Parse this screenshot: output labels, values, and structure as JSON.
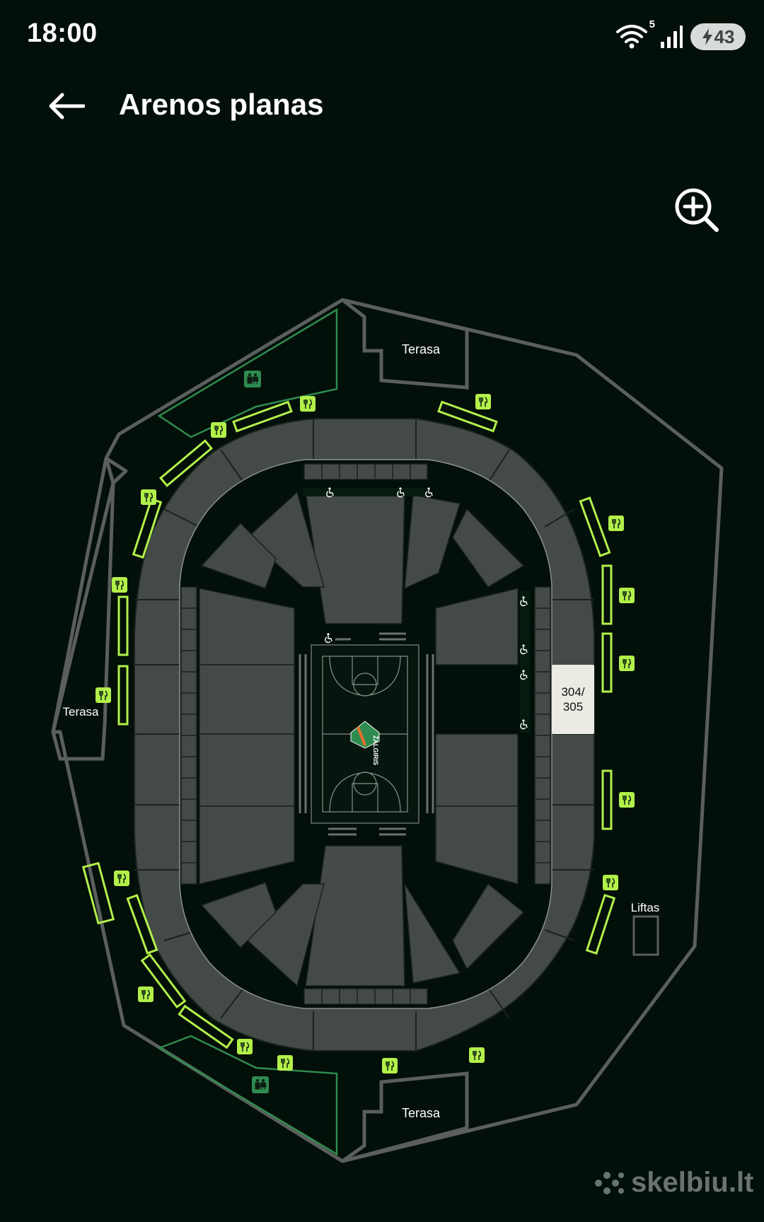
{
  "status_bar": {
    "time": "18:00",
    "wifi_tag": "5",
    "battery_level": "43",
    "icons": [
      "wifi-icon",
      "cellular-signal-icon",
      "battery-charging-icon"
    ]
  },
  "header": {
    "title": "Arenos planas",
    "back_icon": "arrow-left-icon",
    "zoom_icon": "zoom-in-icon"
  },
  "map": {
    "labels": {
      "terrace_top": "Terasa",
      "terrace_left": "Terasa",
      "terrace_bottom": "Terasa",
      "elevator": "Liftas",
      "section_highlight_line1": "304/",
      "section_highlight_line2": "305",
      "court_logo": "ŽALGIRIS"
    },
    "legend_icons": [
      "food-icon",
      "restroom-icon",
      "wheelchair-icon"
    ],
    "colors": {
      "background": "#030f09",
      "outline": "#5a5e5c",
      "seat_section": "#444b47",
      "food_accent": "#b2f04a",
      "restroom_accent": "#2e8b4f",
      "highlight_section": "#ebeae3"
    }
  },
  "watermark": "skelbiu.lt"
}
